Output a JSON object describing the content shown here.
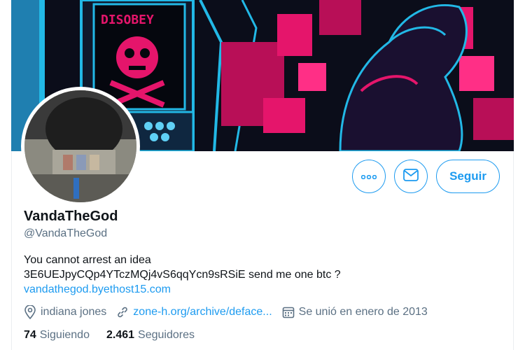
{
  "banner": {
    "sign_text": "DISOBEY",
    "colors": {
      "background": "#0b0d1a",
      "pink": "#e5156b",
      "cyan": "#22b8e6"
    }
  },
  "avatar": {
    "alt": "profile photo"
  },
  "actions": {
    "more_icon": "more-dots-icon",
    "message_icon": "envelope-icon",
    "follow_label": "Seguir"
  },
  "profile": {
    "display_name": "VandaTheGod",
    "handle": "@VandaTheGod",
    "bio_line1": "You cannot arrest an idea",
    "bio_line2": "3E6UEJpyCQp4YTczMQj4vS6qqYcn9sRSiE send me one btc ?",
    "bio_link": "vandathegod.byethost15.com",
    "location": "indiana jones",
    "website": "zone-h.org/archive/deface...",
    "joined": "Se unió en enero de 2013"
  },
  "stats": {
    "following_count": "74",
    "following_label": "Siguiendo",
    "followers_count": "2.461",
    "followers_label": "Seguidores"
  },
  "theme": {
    "accent": "#1d9bf0",
    "muted": "#5b7083",
    "text": "#0f1419"
  }
}
